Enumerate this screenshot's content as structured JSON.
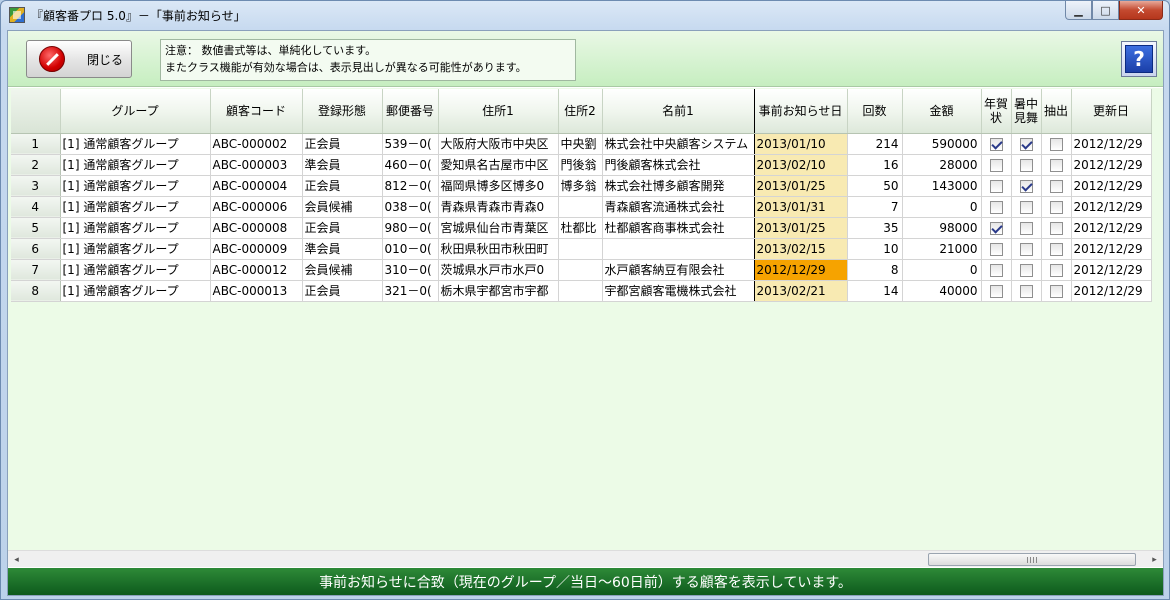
{
  "window": {
    "title": "『顧客番プロ 5.0』－「事前お知らせ」",
    "min_glyph": "▁",
    "max_glyph": "□",
    "close_glyph": "✕"
  },
  "toolbar": {
    "close_label": "閉じる",
    "notice_line1": "注意：  数値書式等は、単純化しています。",
    "notice_line2": "またクラス機能が有効な場合は、表示見出しが異なる可能性があります。",
    "help_glyph": "?"
  },
  "table": {
    "columns": {
      "group": "グループ",
      "code": "顧客コード",
      "reg": "登録形態",
      "zip": "郵便番号",
      "addr1": "住所1",
      "addr2": "住所2",
      "name1": "名前1",
      "date": "事前お知らせ日",
      "count": "回数",
      "amount": "金額",
      "nenga1": "年賀",
      "nenga2": "状",
      "shochu1": "暑中",
      "shochu2": "見舞",
      "chushutsu": "抽出",
      "updated": "更新日"
    },
    "rows": [
      {
        "no": "1",
        "group": "[1] 通常顧客グループ",
        "code": "ABC-000002",
        "reg": "正会員",
        "zip": "539－0(",
        "addr1": "大阪府大阪市中央区",
        "addr2": "中央劉",
        "name1": "株式会社中央顧客システム",
        "date": "2013/01/10",
        "count": "214",
        "amount": "590000",
        "nenga": true,
        "shochu": true,
        "chushutsu": false,
        "updated": "2012/12/29",
        "hot": false
      },
      {
        "no": "2",
        "group": "[1] 通常顧客グループ",
        "code": "ABC-000003",
        "reg": "準会員",
        "zip": "460－0(",
        "addr1": "愛知県名古屋市中区",
        "addr2": "門後翁",
        "name1": "門後顧客株式会社",
        "date": "2013/02/10",
        "count": "16",
        "amount": "28000",
        "nenga": false,
        "shochu": false,
        "chushutsu": false,
        "updated": "2012/12/29",
        "hot": false
      },
      {
        "no": "3",
        "group": "[1] 通常顧客グループ",
        "code": "ABC-000004",
        "reg": "正会員",
        "zip": "812－0(",
        "addr1": "福岡県博多区博多0",
        "addr2": "博多翁",
        "name1": "株式会社博多顧客開発",
        "date": "2013/01/25",
        "count": "50",
        "amount": "143000",
        "nenga": false,
        "shochu": true,
        "chushutsu": false,
        "updated": "2012/12/29",
        "hot": false
      },
      {
        "no": "4",
        "group": "[1] 通常顧客グループ",
        "code": "ABC-000006",
        "reg": "会員候補",
        "zip": "038－0(",
        "addr1": "青森県青森市青森0",
        "addr2": "",
        "name1": "青森顧客流通株式会社",
        "date": "2013/01/31",
        "count": "7",
        "amount": "0",
        "nenga": false,
        "shochu": false,
        "chushutsu": false,
        "updated": "2012/12/29",
        "hot": false
      },
      {
        "no": "5",
        "group": "[1] 通常顧客グループ",
        "code": "ABC-000008",
        "reg": "正会員",
        "zip": "980－0(",
        "addr1": "宮城県仙台市青葉区",
        "addr2": "杜都比",
        "name1": "杜都顧客商事株式会社",
        "date": "2013/01/25",
        "count": "35",
        "amount": "98000",
        "nenga": true,
        "shochu": false,
        "chushutsu": false,
        "updated": "2012/12/29",
        "hot": false
      },
      {
        "no": "6",
        "group": "[1] 通常顧客グループ",
        "code": "ABC-000009",
        "reg": "準会員",
        "zip": "010－0(",
        "addr1": "秋田県秋田市秋田町",
        "addr2": "",
        "name1": "",
        "date": "2013/02/15",
        "count": "10",
        "amount": "21000",
        "nenga": false,
        "shochu": false,
        "chushutsu": false,
        "updated": "2012/12/29",
        "hot": false
      },
      {
        "no": "7",
        "group": "[1] 通常顧客グループ",
        "code": "ABC-000012",
        "reg": "会員候補",
        "zip": "310－0(",
        "addr1": "茨城県水戸市水戸0",
        "addr2": "",
        "name1": "水戸顧客納豆有限会社",
        "date": "2012/12/29",
        "count": "8",
        "amount": "0",
        "nenga": false,
        "shochu": false,
        "chushutsu": false,
        "updated": "2012/12/29",
        "hot": true
      },
      {
        "no": "8",
        "group": "[1] 通常顧客グループ",
        "code": "ABC-000013",
        "reg": "正会員",
        "zip": "321－0(",
        "addr1": "栃木県宇都宮市宇都",
        "addr2": "",
        "name1": "宇都宮顧客電機株式会社",
        "date": "2013/02/21",
        "count": "14",
        "amount": "40000",
        "nenga": false,
        "shochu": false,
        "chushutsu": false,
        "updated": "2012/12/29",
        "hot": false
      }
    ]
  },
  "scroll": {
    "left_glyph": "◂",
    "right_glyph": "▸"
  },
  "status": {
    "text": "事前お知らせに合致（現在のグループ／当日～60日前）する顧客を表示しています。"
  },
  "colors": {
    "date_cell": "#f8eab2",
    "date_hot": "#f6a300",
    "status_bg": "#1a6f28",
    "toolbar_bg": "#d4f2ce"
  }
}
